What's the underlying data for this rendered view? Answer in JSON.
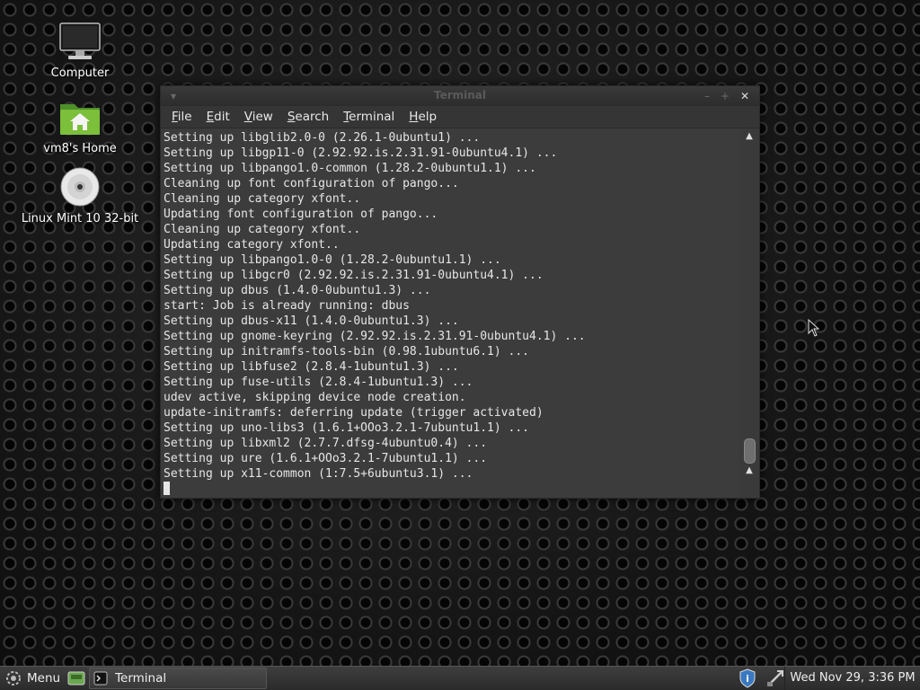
{
  "desktop": {
    "icons": [
      {
        "label": "Computer",
        "icon": "computer-icon"
      },
      {
        "label": "vm8's Home",
        "icon": "home-folder-icon"
      },
      {
        "label": "Linux Mint 10 32-bit",
        "icon": "cdrom-disc-icon"
      }
    ]
  },
  "window": {
    "title": "Terminal",
    "menu": [
      {
        "label": "File",
        "u": "F",
        "rest": "ile"
      },
      {
        "label": "Edit",
        "u": "E",
        "rest": "dit"
      },
      {
        "label": "View",
        "u": "V",
        "rest": "iew"
      },
      {
        "label": "Search",
        "u": "S",
        "rest": "earch"
      },
      {
        "label": "Terminal",
        "u": "T",
        "rest": "erminal"
      },
      {
        "label": "Help",
        "u": "H",
        "rest": "elp"
      }
    ],
    "lines": [
      "Setting up libglib2.0-0 (2.26.1-0ubuntu1) ...",
      "Setting up libgp11-0 (2.92.92.is.2.31.91-0ubuntu4.1) ...",
      "Setting up libpango1.0-common (1.28.2-0ubuntu1.1) ...",
      "Cleaning up font configuration of pango...",
      "Cleaning up category xfont..",
      "Updating font configuration of pango...",
      "Cleaning up category xfont..",
      "Updating category xfont..",
      "Setting up libpango1.0-0 (1.28.2-0ubuntu1.1) ...",
      "Setting up libgcr0 (2.92.92.is.2.31.91-0ubuntu4.1) ...",
      "Setting up dbus (1.4.0-0ubuntu1.3) ...",
      "start: Job is already running: dbus",
      "Setting up dbus-x11 (1.4.0-0ubuntu1.3) ...",
      "Setting up gnome-keyring (2.92.92.is.2.31.91-0ubuntu4.1) ...",
      "Setting up initramfs-tools-bin (0.98.1ubuntu6.1) ...",
      "Setting up libfuse2 (2.8.4-1ubuntu1.3) ...",
      "Setting up fuse-utils (2.8.4-1ubuntu1.3) ...",
      "udev active, skipping device node creation.",
      "update-initramfs: deferring update (trigger activated)",
      "Setting up uno-libs3 (1.6.1+OOo3.2.1-7ubuntu1.1) ...",
      "Setting up libxml2 (2.7.7.dfsg-4ubuntu0.4) ...",
      "Setting up ure (1.6.1+OOo3.2.1-7ubuntu1.1) ...",
      "Setting up x11-common (1:7.5+6ubuntu3.1) ..."
    ]
  },
  "panel": {
    "menu_label": "Menu",
    "task_label": "Terminal",
    "clock": "Wed Nov 29,  3:36 PM"
  }
}
